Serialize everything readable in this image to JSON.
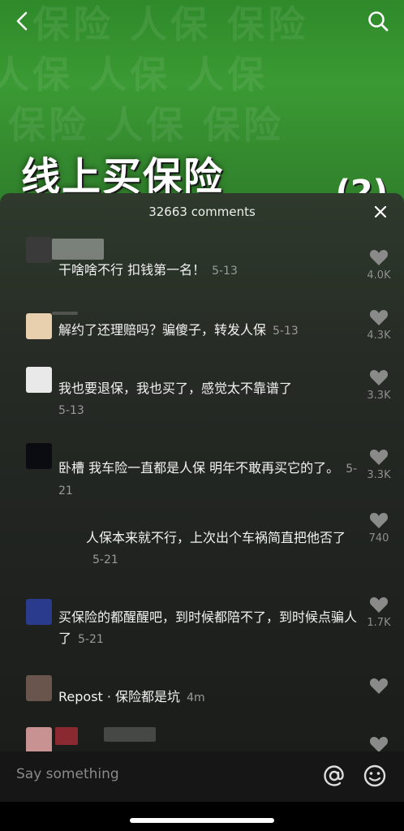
{
  "video": {
    "title_text": "线上买保险",
    "title_suffix": "(2)"
  },
  "comments_header": {
    "title": "32663 comments"
  },
  "comments": [
    {
      "text": "干啥啥不行 扣钱第一名！",
      "time": "5-13",
      "likes": "4.0K",
      "avatar_color": "#3a3a3a"
    },
    {
      "text": "解约了还理赔吗？骗傻子，转发人保",
      "time": "5-13",
      "likes": "4.3K",
      "avatar_color": "#e8cfae"
    },
    {
      "text": "我也要退保，我也买了，感觉太不靠谱了",
      "time": "5-13",
      "likes": "3.3K",
      "avatar_color": "#e9e9e9"
    },
    {
      "text": "卧槽 我车险一直都是人保 明年不敢再买它的了。",
      "time": "5-21",
      "likes": "3.3K",
      "avatar_color": "#0b0b12"
    },
    {
      "text": "人保本来就不行，上次出个车祸简直把他否了",
      "time": "5-21",
      "likes": "740",
      "reply": true
    },
    {
      "text": "买保险的都醒醒吧，到时候都陪不了，到时候点骗人了",
      "time": "5-21",
      "likes": "1.7K",
      "avatar_color": "#2a3a8c"
    },
    {
      "text": "Repost · 保险都是坑",
      "time": "4m",
      "likes": "",
      "avatar_color": "#6a554c"
    },
    {
      "text": "",
      "time": "",
      "likes": "",
      "avatar_color": "#c99292"
    }
  ],
  "input": {
    "placeholder": "Say something"
  },
  "icons": {
    "back": "chevron-left-icon",
    "search": "search-icon",
    "close": "close-icon",
    "like": "heart-icon",
    "mention": "at-icon",
    "emoji": "smiley-icon"
  }
}
